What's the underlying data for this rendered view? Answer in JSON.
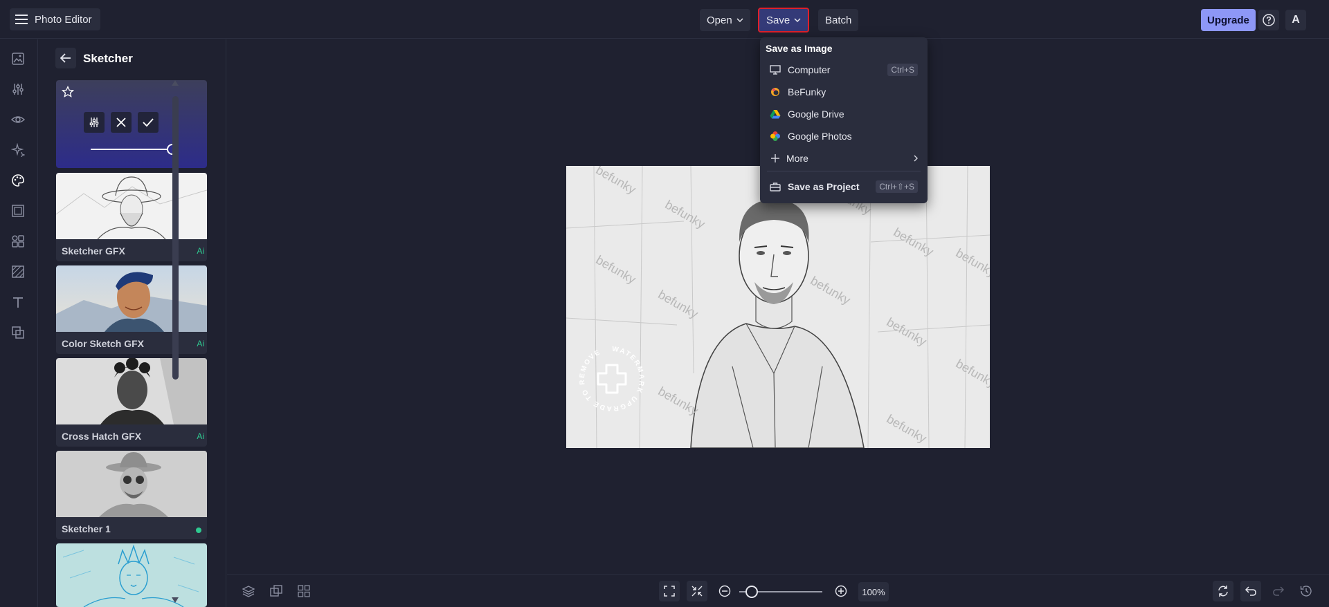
{
  "app": {
    "title": "Photo Editor"
  },
  "topbar": {
    "open_label": "Open",
    "save_label": "Save",
    "batch_label": "Batch",
    "upgrade_label": "Upgrade",
    "avatar_letter": "A"
  },
  "save_menu": {
    "title": "Save as Image",
    "items": [
      {
        "label": "Computer",
        "icon": "monitor-icon",
        "shortcut": "Ctrl+S"
      },
      {
        "label": "BeFunky",
        "icon": "befunky-logo-icon"
      },
      {
        "label": "Google Drive",
        "icon": "google-drive-icon"
      },
      {
        "label": "Google Photos",
        "icon": "google-photos-icon"
      },
      {
        "label": "More",
        "icon": "plus-icon",
        "has_submenu": true
      }
    ],
    "project": {
      "label": "Save as Project",
      "icon": "briefcase-icon",
      "shortcut": "Ctrl+⇧+S"
    }
  },
  "panel": {
    "title": "Sketcher",
    "presets": [
      {
        "label": "Sketcher GFX",
        "badge": "Ai"
      },
      {
        "label": "Color Sketch GFX",
        "badge": "Ai"
      },
      {
        "label": "Cross Hatch GFX",
        "badge": "Ai"
      },
      {
        "label": "Sketcher 1",
        "badge": "dot"
      },
      {
        "label": "",
        "badge": ""
      }
    ],
    "intensity": 1.0
  },
  "rail": {
    "icons": [
      "image-icon",
      "sliders-icon",
      "eye-icon",
      "sparkle-icon",
      "palette-icon",
      "frame-icon",
      "graphics-icon",
      "texture-icon",
      "text-icon",
      "overlay-icon"
    ],
    "active_index": 4
  },
  "canvas": {
    "watermark_text": "befunky",
    "badge_text": "WATERMARK UPGRADE TO REMOVE"
  },
  "bottombar": {
    "zoom_level": "100%",
    "zoom_fraction": 0.15
  },
  "colors": {
    "background": "#1f2130",
    "surface": "#2a2d3d",
    "accent": "#8d97f6",
    "save_highlight": "#e0202a",
    "ai_green": "#2ec990"
  }
}
